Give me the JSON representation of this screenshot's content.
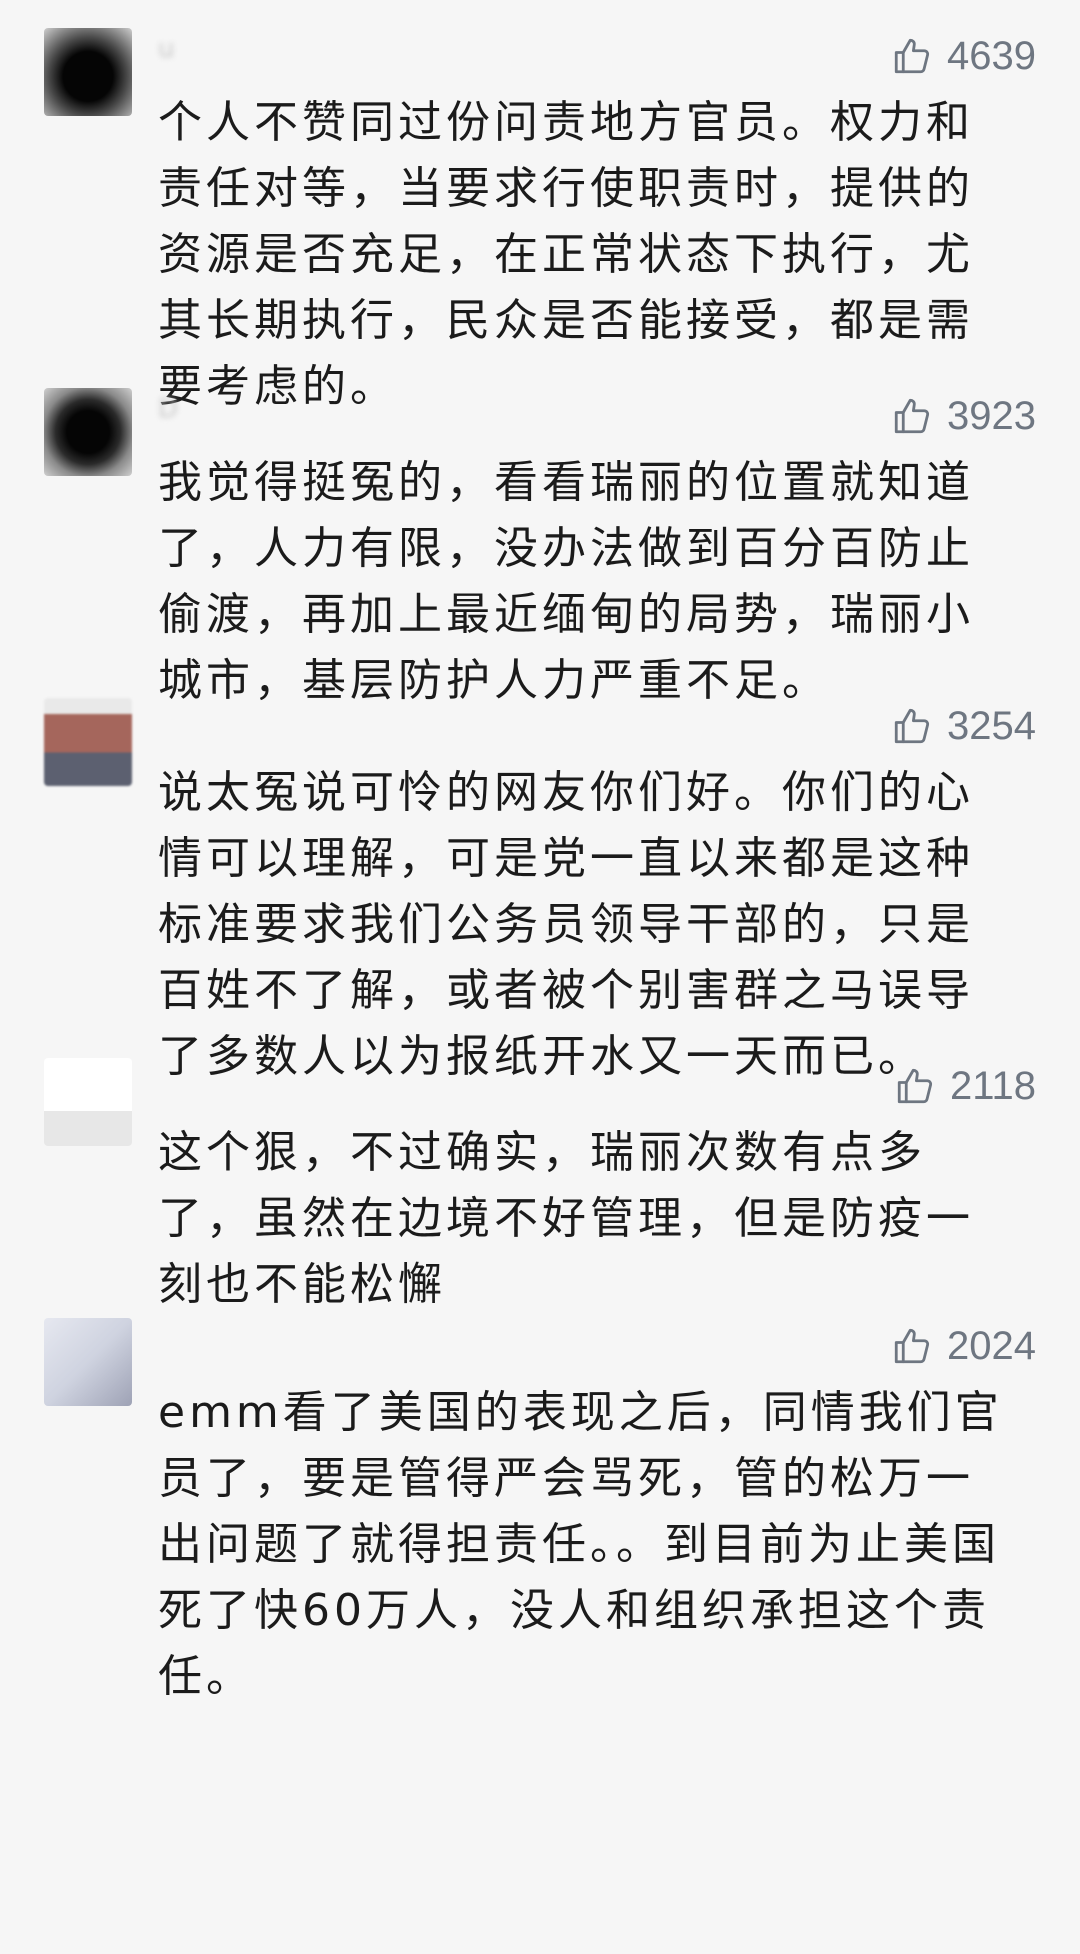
{
  "comments": [
    {
      "likes": "4639",
      "username": "u",
      "text": "个人不赞同过份问责地方官员。权力和责任对等，当要求行使职责时，提供的资源是否充足，在正常状态下执行，尤其长期执行，民众是否能接受，都是需要考虑的。"
    },
    {
      "likes": "3923",
      "username": "D",
      "text": "我觉得挺冤的，看看瑞丽的位置就知道了，人力有限，没办法做到百分百防止偷渡，再加上最近缅甸的局势，瑞丽小城市，基层防护人力严重不足。"
    },
    {
      "likes": "3254",
      "username": "",
      "text": "说太冤说可怜的网友你们好。你们的心情可以理解，可是党一直以来都是这种标准要求我们公务员领导干部的，只是百姓不了解，或者被个别害群之马误导了多数人以为报纸开水又一天而已。"
    },
    {
      "likes": "2118",
      "username": "",
      "text": "这个狠，不过确实，瑞丽次数有点多了，虽然在边境不好管理，但是防疫一刻也不能松懈"
    },
    {
      "likes": "2024",
      "username": "",
      "text": "emm看了美国的表现之后，同情我们官员了，要是管得严会骂死，管的松万一出问题了就得担责任。。到目前为止美国死了快60万人，没人和组织承担这个责任。"
    }
  ],
  "colors": {
    "background": "#f6f6f6",
    "text": "#1b1b1b",
    "like": "#6e7681"
  },
  "icons": {
    "like": "thumbs-up-icon"
  }
}
